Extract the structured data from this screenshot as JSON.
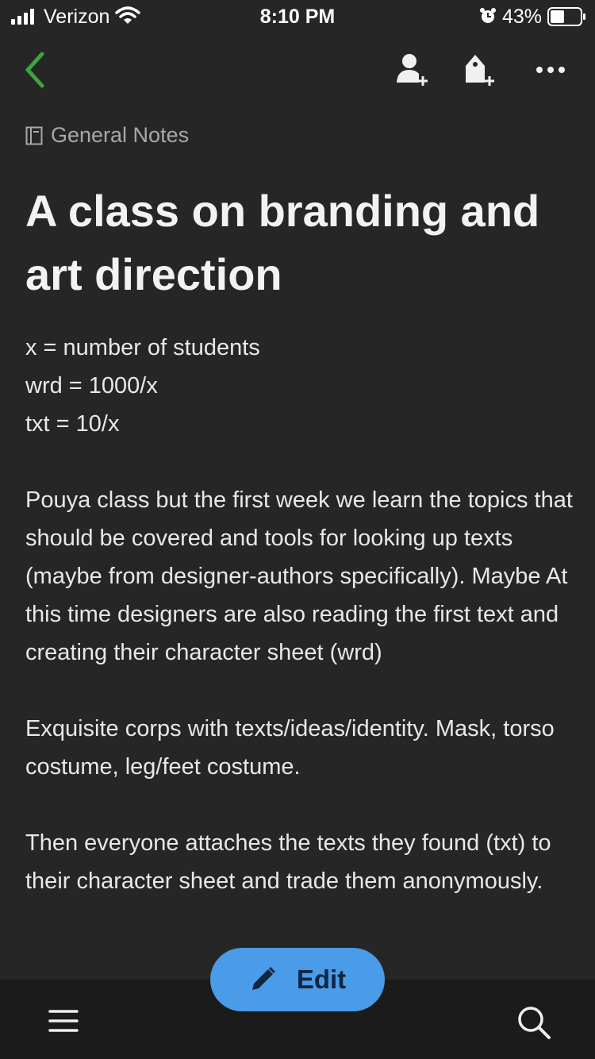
{
  "status_bar": {
    "carrier": "Verizon",
    "time": "8:10 PM",
    "battery": "43%"
  },
  "toolbar": {
    "back_icon": "chevron-left-icon",
    "share_icon": "add-person-icon",
    "tag_icon": "add-tag-icon",
    "more_icon": "more-horizontal-icon",
    "accent": "#3fa33f"
  },
  "note": {
    "notebook": "General Notes",
    "title": "A class on branding and art direction",
    "lines": [
      "x = number of students",
      "wrd = 1000/x",
      "txt = 10/x"
    ],
    "paragraphs": [
      "Pouya class but the first week we learn the topics that should be covered and tools for looking up texts (maybe from designer-authors specifically). Maybe At this time designers are also reading the first text and creating their character sheet (wrd)",
      "Exquisite corps with texts/ideas/identity. Mask, torso costume, leg/feet costume.",
      "Then everyone attaches the texts they found (txt) to their character sheet and trade them anonymously."
    ]
  },
  "bottom_bar": {
    "edit_label": "Edit",
    "edit_color": "#4a9be8",
    "menu_icon": "hamburger-menu-icon",
    "search_icon": "search-icon"
  }
}
